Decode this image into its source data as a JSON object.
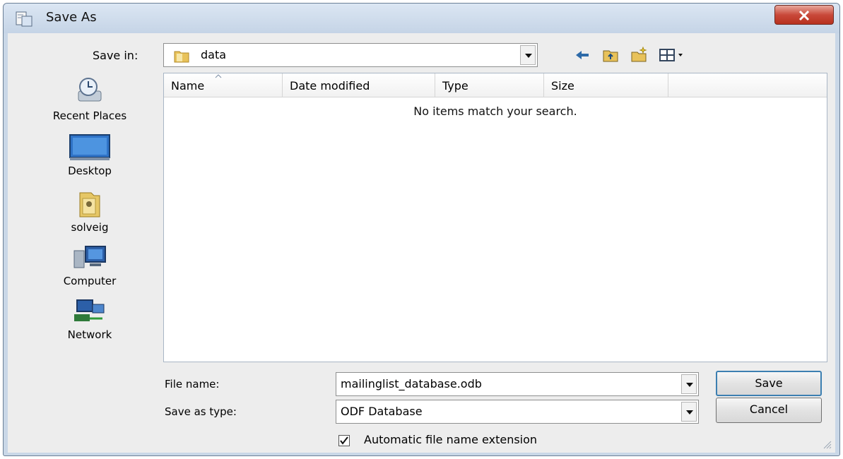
{
  "window": {
    "title": "Save As"
  },
  "toolbar": {
    "save_in_label": "Save in:",
    "save_in_value": "data",
    "icons": [
      "back-icon",
      "up-folder-icon",
      "new-folder-icon",
      "views-icon"
    ]
  },
  "places": [
    {
      "label": "Recent Places",
      "icon": "recent-places-icon"
    },
    {
      "label": "Desktop",
      "icon": "desktop-icon"
    },
    {
      "label": "solveig",
      "icon": "user-folder-icon"
    },
    {
      "label": "Computer",
      "icon": "computer-icon"
    },
    {
      "label": "Network",
      "icon": "network-icon"
    }
  ],
  "filelist": {
    "columns": [
      "Name",
      "Date modified",
      "Type",
      "Size"
    ],
    "empty_message": "No items match your search."
  },
  "form": {
    "file_name_label": "File name:",
    "file_name_value": "mailinglist_database.odb",
    "save_type_label": "Save as type:",
    "save_type_value": "ODF Database",
    "auto_ext_label": "Automatic file name extension",
    "auto_ext_checked": true
  },
  "buttons": {
    "save": "Save",
    "cancel": "Cancel"
  }
}
